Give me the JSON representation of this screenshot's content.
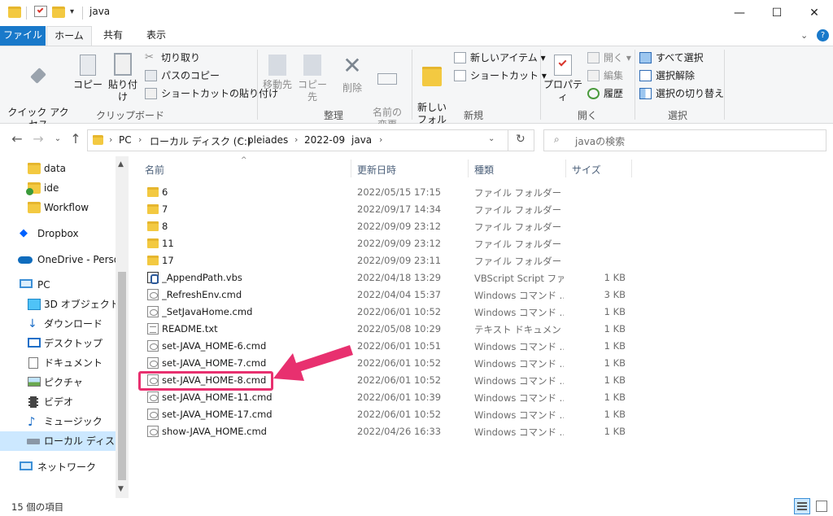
{
  "window": {
    "title": "java",
    "controls": {
      "minimize": "—",
      "maximize": "☐",
      "close": "✕"
    }
  },
  "tabs": [
    "ファイル",
    "ホーム",
    "共有",
    "表示"
  ],
  "ribbon": {
    "clipboard": {
      "label": "クリップボード",
      "pin": "クイック アクセス\nにピン留めする",
      "copy": "コピー",
      "paste": "貼り付け",
      "cut": "切り取り",
      "copy_path": "パスのコピー",
      "paste_shortcut": "ショートカットの貼り付け"
    },
    "organize": {
      "label": "整理",
      "move_to": "移動先",
      "copy_to": "コピー先",
      "delete": "削除",
      "rename": "名前の\n変更"
    },
    "new": {
      "label": "新規",
      "new_folder": "新しい\nフォルダー",
      "new_item": "新しいアイテム",
      "shortcut": "ショートカット"
    },
    "open": {
      "label": "開く",
      "properties": "プロパティ",
      "open": "開く",
      "edit": "編集",
      "history": "履歴"
    },
    "select": {
      "label": "選択",
      "select_all": "すべて選択",
      "select_none": "選択解除",
      "invert": "選択の切り替え"
    }
  },
  "address": {
    "crumbs": [
      "PC",
      "ローカル ディスク (C:)",
      "pleiades",
      "2022-09",
      "java"
    ],
    "search_placeholder": "javaの検索"
  },
  "nav": {
    "items": [
      {
        "label": "data",
        "icon": "folder-icon"
      },
      {
        "label": "ide",
        "icon": "folder-synced-icon"
      },
      {
        "label": "Workflow",
        "icon": "folder-icon"
      },
      {
        "label": "Dropbox",
        "icon": "dropbox-icon"
      },
      {
        "label": "OneDrive - Person",
        "icon": "onedrive-icon"
      },
      {
        "label": "PC",
        "icon": "pc-icon"
      },
      {
        "label": "3D オブジェクト",
        "icon": "3d-objects-icon"
      },
      {
        "label": "ダウンロード",
        "icon": "download-icon"
      },
      {
        "label": "デスクトップ",
        "icon": "desktop-icon"
      },
      {
        "label": "ドキュメント",
        "icon": "documents-icon"
      },
      {
        "label": "ピクチャ",
        "icon": "pictures-icon"
      },
      {
        "label": "ビデオ",
        "icon": "videos-icon"
      },
      {
        "label": "ミュージック",
        "icon": "music-icon"
      },
      {
        "label": "ローカル ディスク (C",
        "icon": "drive-icon"
      },
      {
        "label": "ネットワーク",
        "icon": "network-icon"
      }
    ]
  },
  "columns": {
    "name": "名前",
    "date": "更新日時",
    "type": "種類",
    "size": "サイズ"
  },
  "files": [
    {
      "name": "6",
      "date": "2022/05/15 17:15",
      "type": "ファイル フォルダー",
      "size": "",
      "icon": "folder"
    },
    {
      "name": "7",
      "date": "2022/09/17 14:34",
      "type": "ファイル フォルダー",
      "size": "",
      "icon": "folder"
    },
    {
      "name": "8",
      "date": "2022/09/09 23:12",
      "type": "ファイル フォルダー",
      "size": "",
      "icon": "folder"
    },
    {
      "name": "11",
      "date": "2022/09/09 23:12",
      "type": "ファイル フォルダー",
      "size": "",
      "icon": "folder"
    },
    {
      "name": "17",
      "date": "2022/09/09 23:11",
      "type": "ファイル フォルダー",
      "size": "",
      "icon": "folder"
    },
    {
      "name": "_AppendPath.vbs",
      "date": "2022/04/18 13:29",
      "type": "VBScript Script ファ...",
      "size": "1 KB",
      "icon": "vbs"
    },
    {
      "name": "_RefreshEnv.cmd",
      "date": "2022/04/04 15:37",
      "type": "Windows コマンド ...",
      "size": "3 KB",
      "icon": "cmd"
    },
    {
      "name": "_SetJavaHome.cmd",
      "date": "2022/06/01 10:52",
      "type": "Windows コマンド ...",
      "size": "1 KB",
      "icon": "cmd"
    },
    {
      "name": "README.txt",
      "date": "2022/05/08 10:29",
      "type": "テキスト ドキュメント",
      "size": "1 KB",
      "icon": "txt"
    },
    {
      "name": "set-JAVA_HOME-6.cmd",
      "date": "2022/06/01 10:51",
      "type": "Windows コマンド ...",
      "size": "1 KB",
      "icon": "cmd"
    },
    {
      "name": "set-JAVA_HOME-7.cmd",
      "date": "2022/06/01 10:52",
      "type": "Windows コマンド ...",
      "size": "1 KB",
      "icon": "cmd"
    },
    {
      "name": "set-JAVA_HOME-8.cmd",
      "date": "2022/06/01 10:52",
      "type": "Windows コマンド ...",
      "size": "1 KB",
      "icon": "cmd"
    },
    {
      "name": "set-JAVA_HOME-11.cmd",
      "date": "2022/06/01 10:39",
      "type": "Windows コマンド ...",
      "size": "1 KB",
      "icon": "cmd"
    },
    {
      "name": "set-JAVA_HOME-17.cmd",
      "date": "2022/06/01 10:52",
      "type": "Windows コマンド ...",
      "size": "1 KB",
      "icon": "cmd"
    },
    {
      "name": "show-JAVA_HOME.cmd",
      "date": "2022/04/26 16:33",
      "type": "Windows コマンド ...",
      "size": "1 KB",
      "icon": "cmd"
    }
  ],
  "highlight": {
    "color": "#e8306f"
  },
  "status": {
    "count": "15 個の項目"
  },
  "colors": {
    "accent": "#1979ca",
    "selection": "#cce8ff",
    "folder": "#f3c941"
  }
}
